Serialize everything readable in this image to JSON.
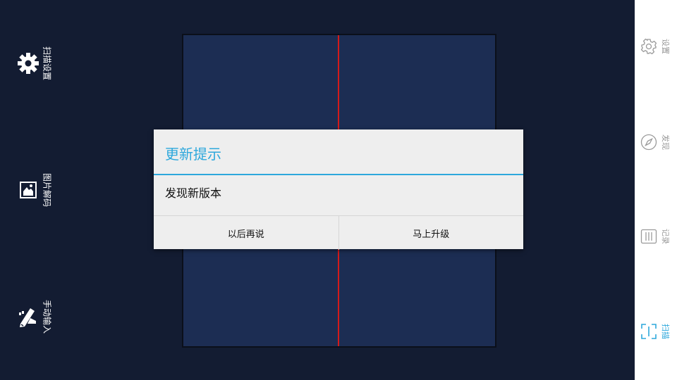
{
  "left_tools": [
    {
      "label": "扫描设置",
      "icon": "gear-icon"
    },
    {
      "label": "图片解码",
      "icon": "image-icon"
    },
    {
      "label": "手动输入",
      "icon": "pencil-icon"
    }
  ],
  "right_nav": [
    {
      "label": "设置",
      "icon": "gear-icon",
      "active": false
    },
    {
      "label": "发现",
      "icon": "compass-icon",
      "active": false
    },
    {
      "label": "记录",
      "icon": "list-icon",
      "active": false
    },
    {
      "label": "扫描",
      "icon": "scan-icon",
      "active": true
    }
  ],
  "dialog": {
    "title": "更新提示",
    "message": "发现新版本",
    "later_label": "以后再说",
    "upgrade_label": "马上升级"
  },
  "colors": {
    "accent": "#2ea8dc",
    "background": "#131c32",
    "scan_area": "#1c2d53",
    "scan_line": "#d41a1a"
  }
}
